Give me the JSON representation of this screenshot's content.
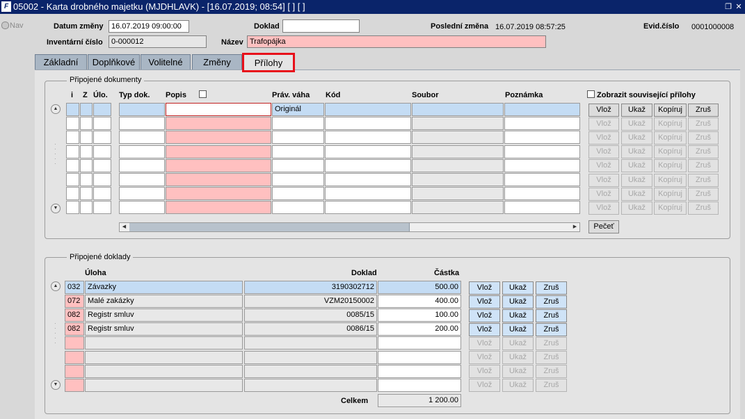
{
  "window": {
    "title": "05002 - Karta drobného majetku (MJDHLAVK) - [16.07.2019; 08:54]  [ ]  [ ]",
    "logo": "F"
  },
  "nav": {
    "label": "Nav"
  },
  "header": {
    "datum_zmeny_label": "Datum změny",
    "datum_zmeny_value": "16.07.2019 09:00:00",
    "doklad_label": "Doklad",
    "doklad_value": "",
    "posledni_zmena_label": "Poslední změna",
    "posledni_zmena_value": "16.07.2019 08:57:25",
    "evid_cislo_label": "Evid.číslo",
    "evid_cislo_value": "0001000008",
    "inventarni_cislo_label": "Inventární číslo",
    "inventarni_cislo_value": "0-000012",
    "nazev_label": "Název",
    "nazev_value": "Trafopájka"
  },
  "tabs": [
    {
      "label": "Základní"
    },
    {
      "label": "Doplňkové"
    },
    {
      "label": "Volitelné"
    },
    {
      "label": "Změny"
    },
    {
      "label": "Přílohy"
    }
  ],
  "dokumenty": {
    "title": "Připojené dokumenty",
    "columns": {
      "i": "i",
      "z": "Z",
      "ulo": "Úlo.",
      "typ": "Typ dok.",
      "popis": "Popis",
      "prav": "Práv. váha",
      "kod": "Kód",
      "soubor": "Soubor",
      "poznamka": "Poznámka"
    },
    "show_related_label": "Zobrazit související přílohy",
    "rows": [
      {
        "prav": "Originál"
      },
      {
        "prav": ""
      },
      {
        "prav": ""
      },
      {
        "prav": ""
      },
      {
        "prav": ""
      },
      {
        "prav": ""
      },
      {
        "prav": ""
      },
      {
        "prav": ""
      }
    ],
    "buttons": {
      "vloz": "Vlož",
      "ukaz": "Ukaž",
      "kopiruj": "Kopíruj",
      "zrus": "Zruš"
    },
    "pecet": "Pečeť"
  },
  "doklady": {
    "title": "Připojené doklady",
    "columns": {
      "uloha": "Úloha",
      "doklad": "Doklad",
      "castka": "Částka"
    },
    "rows": [
      {
        "code": "032",
        "uloha": "Závazky",
        "doklad": "3190302712",
        "castka": "500.00"
      },
      {
        "code": "072",
        "uloha": "Malé zakázky",
        "doklad": "VZM20150002",
        "castka": "400.00"
      },
      {
        "code": "082",
        "uloha": "Registr smluv",
        "doklad": "0085/15",
        "castka": "100.00"
      },
      {
        "code": "082",
        "uloha": "Registr smluv",
        "doklad": "0086/15",
        "castka": "200.00"
      },
      {
        "code": "",
        "uloha": "",
        "doklad": "",
        "castka": ""
      },
      {
        "code": "",
        "uloha": "",
        "doklad": "",
        "castka": ""
      },
      {
        "code": "",
        "uloha": "",
        "doklad": "",
        "castka": ""
      },
      {
        "code": "",
        "uloha": "",
        "doklad": "",
        "castka": ""
      }
    ],
    "buttons": {
      "vloz": "Vlož",
      "ukaz": "Ukaž",
      "zrus": "Zruš"
    },
    "celkem_label": "Celkem",
    "celkem_value": "1 200.00"
  }
}
